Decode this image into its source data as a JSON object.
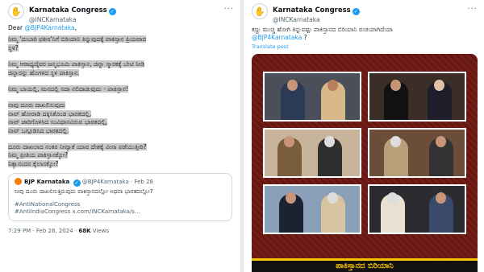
{
  "left": {
    "name": "Karnataka Congress",
    "handle": "@INCKarnataka",
    "greeting_prefix": "Dear ",
    "greeting_mention": "@BJP4Karnataka",
    "greeting_suffix": ",",
    "lines": [
      "ನಿಮ್ಮ 'ದುಬಾರಿ ಫಕೀರ'ನಿಗೆ ಬಿರಿಯಾನಿ ತಿನ್ನುವುದಕ್ಕೆ ಪಾಕಿಸ್ತಾನ ಪ್ರಿಯವಾದ",
      "ಸ್ಥಳ?",
      "",
      "ನಿಮ್ಮ ಆರಾಧ್ಯದೈವರ ಜನ್ಮಭೂಮಿ ಪಾಕಿಸ್ತಾನ, ಜಿನ್ನಾ ಸ್ಮಾರಕಕ್ಕೆ ಬೇಟಿ ನೀಡಿ",
      "ಜಿನ್ನಾರನ್ನು ಹೊಗಳಿದ ಸ್ಥಳ ಪಾಕಿಸ್ತಾನ.",
      "",
      "ನಿಮ್ಮ ಬಾಯಲ್ಲಿ, ಮನದಲ್ಲಿ ಸದಾ ನಲಿದಾಡುವುದು - ಪಾಕಿಸ್ತಾನ!",
      "",
      "ನಾವು ದೂರು ದಾಖಲಿಸುವುದು",
      "ನಾವ್ ಹೋರಾಡಿ ದಕ್ಕಿಸಿಕೊಂಡ ಭಾರತದಲ್ಲಿ,",
      "ನಾವ್ ಜಾರಿಗೊಳಿಸಿದ ಸಂವಿಧಾನವಿರುವ ಭಾರತದಲ್ಲಿ,",
      "ನಾವ್ ಒಗ್ಗೂಡಿಸಿದ ಭಾರತದಲ್ಲಿ.",
      "",
      "ದೂರು ದಾಖಲಾದ ನಂತರ ನೀವ್ಯಾಕೆ ಯಾವ ದೇಶಕ್ಕೆ ವೀಸಾ ಪಡೆಯುತ್ತೀರಿ?",
      "ನಿಮ್ಮ ಪ್ರೀತಿಯ ಪಾಕಿಸ್ತಾನಕ್ಕೋ?",
      "ನಿತ್ಯಾನಂದನ ಕೈಲಾಸಕ್ಕೋ?"
    ],
    "quote": {
      "name": "BJP Karnataka",
      "handle": "@BJP4Karnataka",
      "date": "· Feb 28",
      "text": "ನೀವು ದೂರು ದಾಖಲಿಸುತ್ತಿರುವುದು ಪಾಕಿಸ್ತಾನದಲ್ಲೋ ಅಥವಾ ಭಾರತದಲ್ಲೋ?",
      "tag1": "#AntiNationalCongress",
      "tag2": "#AntiIndiaCongress x.com/INCKarnataka/s..."
    },
    "footer_time": "7:29 PM · Feb 28, 2024 · ",
    "footer_views_num": "68K",
    "footer_views_label": " Views"
  },
  "right": {
    "name": "Karnataka Congress",
    "handle": "@INCKarnataka",
    "line1": "ಕದ್ದು ಮುಚ್ಚಿ ಹೋಗಿ ತಿನ್ನುವಷ್ಟು ಪಾಕಿಸ್ತಾನದ ಬಿರಿಯಾನಿ ರುಚಿಯಾಗಿದೆಯಾ",
    "mention": "@BJP4Karnataka",
    "mention_suffix": " ?",
    "translate": "Translate post",
    "banner": "ಪಾಕಿಸ್ತಾನದ ಬಿರಿಯಾನಿ"
  },
  "colors": {
    "accent": "#1d9bf0",
    "highlight": "#c8c8c8",
    "media_bg": "#6e1b15",
    "banner_text": "#f5c400"
  },
  "icons": {
    "verified": "verified-badge-icon",
    "more": "more-options-icon",
    "avatar": "congress-logo-avatar"
  }
}
